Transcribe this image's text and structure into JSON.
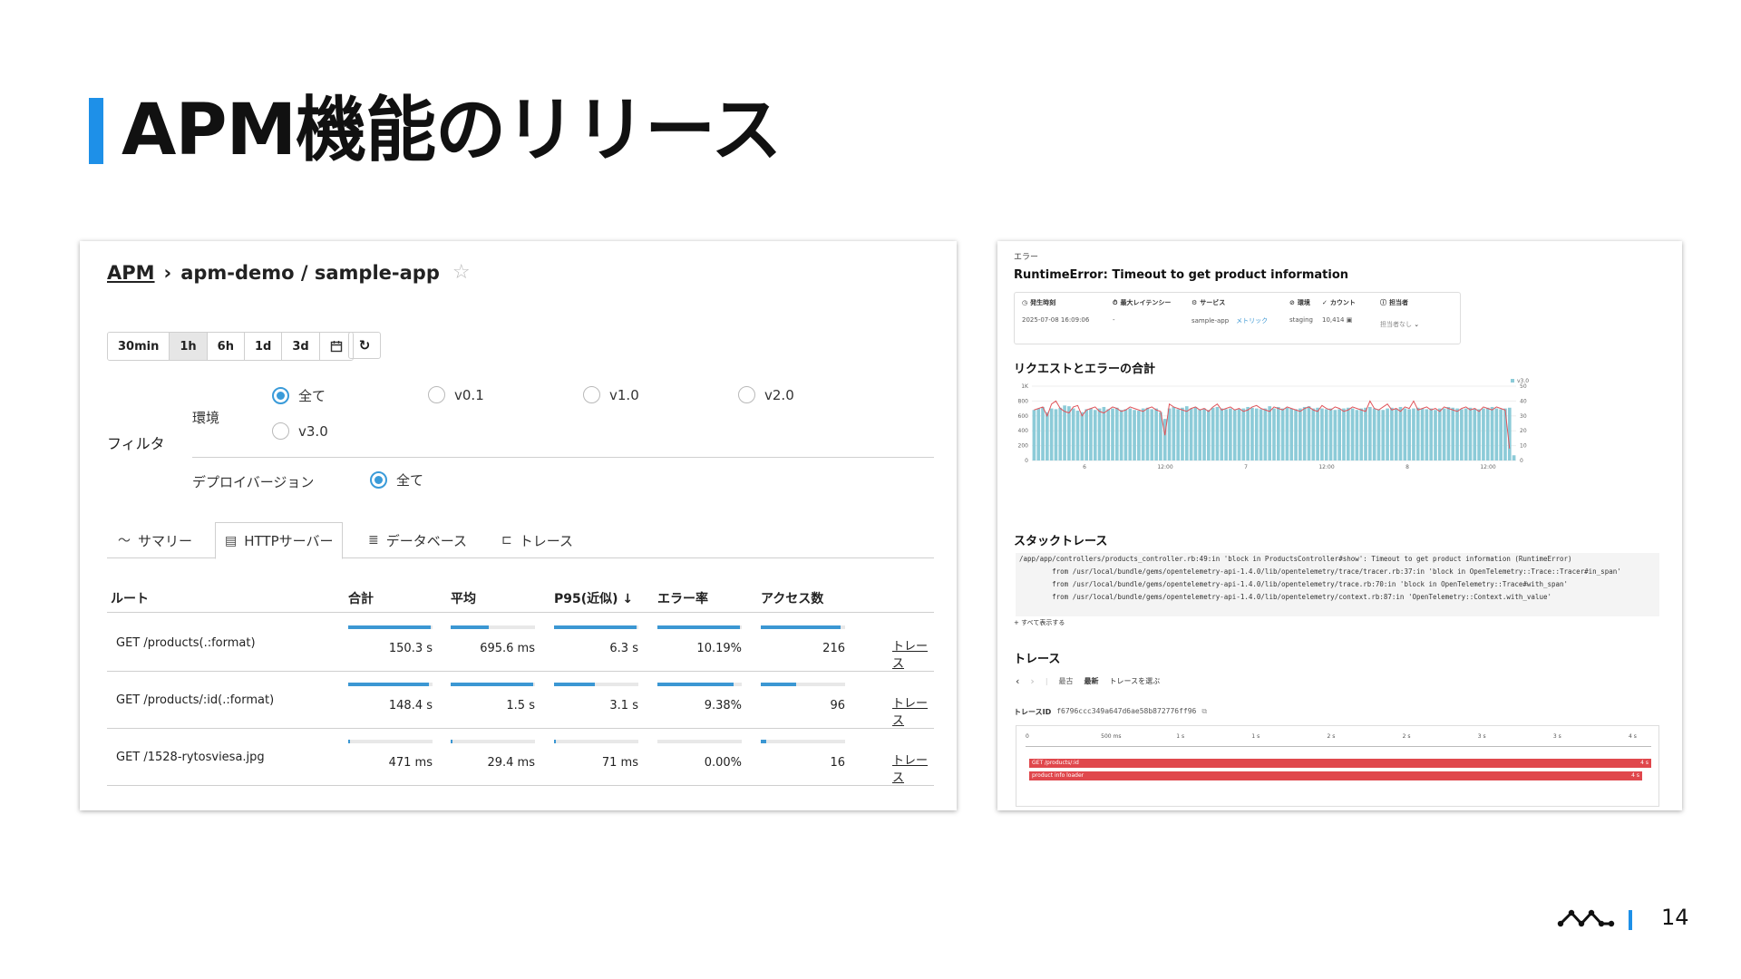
{
  "slide": {
    "title": "APM機能のリリース",
    "page_number": "14"
  },
  "left": {
    "breadcrumb": {
      "root": "APM",
      "path": "apm-demo / sample-app"
    },
    "time_buttons": [
      "30min",
      "1h",
      "6h",
      "1d",
      "3d"
    ],
    "time_selected": "1h",
    "filter_label": "フィルタ",
    "env_label": "環境",
    "env_options": [
      "全て",
      "v0.1",
      "v1.0",
      "v2.0",
      "v3.0"
    ],
    "env_selected": "全て",
    "deploy_label": "デプロイバージョン",
    "deploy_options": [
      "全て"
    ],
    "tabs": [
      "サマリー",
      "HTTPサーバー",
      "データベース",
      "トレース"
    ],
    "active_tab": "HTTPサーバー",
    "table": {
      "headers": [
        "ルート",
        "合計",
        "平均",
        "P95(近似) ↓",
        "エラー率",
        "アクセス数"
      ],
      "rows": [
        {
          "route": "GET /products(.:format)",
          "total": "150.3 s",
          "avg": "695.6 ms",
          "p95": "6.3 s",
          "error_rate": "10.19%",
          "access": "216",
          "link": "トレース",
          "bars": [
            0.98,
            0.45,
            0.98,
            0.98,
            0.95
          ]
        },
        {
          "route": "GET /products/:id(.:format)",
          "total": "148.4 s",
          "avg": "1.5 s",
          "p95": "3.1 s",
          "error_rate": "9.38%",
          "access": "96",
          "link": "トレース",
          "bars": [
            0.96,
            0.98,
            0.48,
            0.9,
            0.42
          ]
        },
        {
          "route": "GET /1528-rytosviesa.jpg",
          "total": "471 ms",
          "avg": "29.4 ms",
          "p95": "71 ms",
          "error_rate": "0.00%",
          "access": "16",
          "link": "トレース",
          "bars": [
            0.02,
            0.02,
            0.02,
            0.0,
            0.06
          ]
        }
      ]
    }
  },
  "right": {
    "section_label": "エラー",
    "error_title": "RuntimeError: Timeout to get product information",
    "meta": [
      {
        "head": "発生時刻",
        "value": "2025-07-08 16:09:06"
      },
      {
        "head": "最大レイテンシー",
        "value": "-"
      },
      {
        "head": "サービス",
        "value": "sample-app",
        "link": "メトリック"
      },
      {
        "head": "環境",
        "value": "staging"
      },
      {
        "head": "カウント",
        "value": "10,414"
      },
      {
        "head": "担当者",
        "value": "担当者なし"
      }
    ],
    "chart_title": "リクエストとエラーの合計",
    "stack_title": "スタックトレース",
    "stack_lines": [
      "/app/app/controllers/products_controller.rb:49:in 'block in ProductsController#show': Timeout to get product information (RuntimeError)",
      "        from /usr/local/bundle/gems/opentelemetry-api-1.4.0/lib/opentelemetry/trace/tracer.rb:37:in 'block in OpenTelemetry::Trace::Tracer#in_span'",
      "        from /usr/local/bundle/gems/opentelemetry-api-1.4.0/lib/opentelemetry/trace.rb:70:in 'block in OpenTelemetry::Trace#with_span'",
      "        from /usr/local/bundle/gems/opentelemetry-api-1.4.0/lib/opentelemetry/context.rb:87:in 'OpenTelemetry::Context.with_value'"
    ],
    "show_all": "すべて表示する",
    "trace_title": "トレース",
    "trace_nav": {
      "oldest": "最古",
      "latest": "最新",
      "pick": "トレースを選ぶ"
    },
    "trace_id_label": "トレースID",
    "trace_id": "f6796ccc349a647d6ae58b872776ff96",
    "waterfall": {
      "ticks": [
        "0",
        "500 ms",
        "1 s",
        "1 s",
        "2 s",
        "2 s",
        "3 s",
        "3 s",
        "4 s"
      ],
      "spans": [
        {
          "name": "GET /products/:id",
          "duration": "4 s"
        },
        {
          "name": "product info loader",
          "duration": "4 s"
        }
      ]
    }
  },
  "chart_data": {
    "type": "bar",
    "title": "リクエストとエラーの合計",
    "legend": [
      "v3.0"
    ],
    "legend_position": "top-right",
    "x_tick_labels": [
      "6",
      "12:00",
      "7",
      "12:00",
      "8",
      "12:00"
    ],
    "y_left": {
      "ticks": [
        "0",
        "200",
        "400",
        "600",
        "800",
        "1K"
      ],
      "range": [
        0,
        1000
      ]
    },
    "y_right": {
      "ticks": [
        "0",
        "10",
        "20",
        "30",
        "40",
        "50"
      ],
      "range": [
        0,
        50
      ]
    },
    "bar_color": "#8ccbd8",
    "line_color": "#e0545a",
    "series": [
      {
        "name": "requests",
        "axis": "left",
        "values": [
          680,
          700,
          720,
          650,
          700,
          690,
          710,
          740,
          730,
          700,
          670,
          650,
          690,
          700,
          680,
          700,
          720,
          690,
          700,
          710,
          680,
          690,
          700,
          680,
          670,
          700,
          710,
          690,
          700,
          650,
          560,
          700,
          720,
          690,
          710,
          730,
          700,
          720,
          690,
          700,
          680,
          710,
          720,
          700,
          690,
          700,
          680,
          690,
          700,
          720,
          710,
          700,
          690,
          700,
          730,
          700,
          720,
          700,
          710,
          700,
          690,
          700,
          720,
          730,
          700,
          710,
          700,
          690,
          700,
          680,
          690,
          700,
          710,
          700,
          680,
          700,
          710,
          720,
          700,
          690,
          680,
          700,
          710,
          700,
          720,
          700,
          690,
          700,
          710,
          700,
          690,
          700,
          680,
          700,
          700,
          720,
          710,
          700,
          690,
          700,
          710,
          700,
          690,
          700,
          710,
          720,
          700,
          690,
          700,
          710,
          70
        ]
      },
      {
        "name": "errors",
        "axis": "right",
        "values": [
          34,
          35,
          36,
          30,
          38,
          40,
          35,
          33,
          32,
          36,
          37,
          30,
          34,
          35,
          36,
          33,
          32,
          34,
          36,
          35,
          33,
          34,
          36,
          35,
          34,
          33,
          35,
          36,
          34,
          33,
          17,
          38,
          36,
          35,
          34,
          33,
          35,
          36,
          34,
          35,
          33,
          36,
          38,
          34,
          35,
          36,
          34,
          35,
          33,
          34,
          36,
          37,
          35,
          34,
          33,
          36,
          35,
          34,
          36,
          35,
          34,
          33,
          35,
          36,
          34,
          33,
          37,
          35,
          34,
          36,
          35,
          33,
          34,
          36,
          35,
          34,
          33,
          40,
          35,
          34,
          36,
          38,
          34,
          35,
          33,
          36,
          35,
          40,
          34,
          35,
          36,
          34,
          35,
          33,
          36,
          35,
          34,
          33,
          35,
          36,
          34,
          35,
          33,
          36,
          35,
          34,
          36,
          35,
          34,
          8
        ]
      }
    ]
  }
}
